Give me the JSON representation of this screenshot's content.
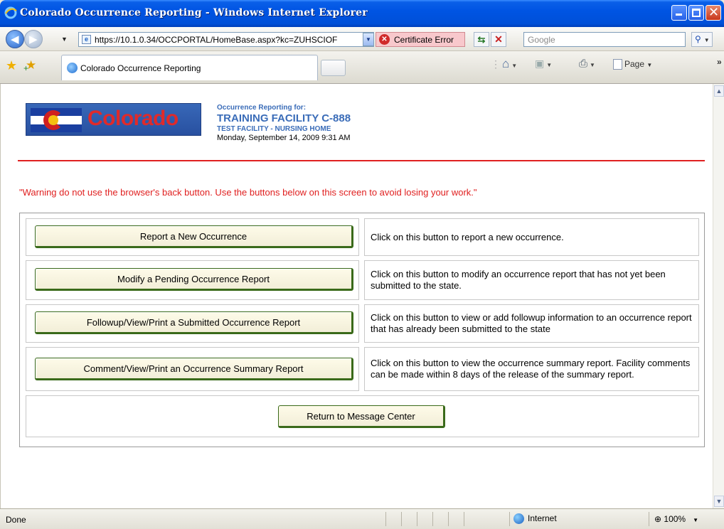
{
  "window": {
    "title": "Colorado Occurrence Reporting - Windows Internet Explorer"
  },
  "address_bar": {
    "url": "https://10.1.0.34/OCCPORTAL/HomeBase.aspx?kc=ZUHSCIOF",
    "cert_error": "Certificate Error",
    "search_placeholder": "Google"
  },
  "tabs": [
    {
      "label": "Colorado Occurrence Reporting"
    }
  ],
  "toolbar": {
    "page_label": "Page"
  },
  "header": {
    "logo_text": "Colorado",
    "reporting_for": "Occurrence Reporting for:",
    "facility_name": "TRAINING FACILITY C-888",
    "facility_type": "TEST FACILITY - NURSING HOME",
    "datetime": "Monday, September 14, 2009 9:31 AM"
  },
  "warning": "\"Warning do not use the browser's back button. Use the buttons below on this screen to avoid losing your work.\"",
  "actions": [
    {
      "button": "Report a New Occurrence",
      "description": "Click on this button to report a new occurrence."
    },
    {
      "button": "Modify a Pending Occurrence Report",
      "description": "Click on this button to modify an occurrence report that has not yet been submitted to the state."
    },
    {
      "button": "Followup/View/Print a Submitted Occurrence Report",
      "description": "Click on this button to view or add followup information to an occurrence report that has already been submitted to the state"
    },
    {
      "button": "Comment/View/Print an Occurrence Summary Report",
      "description": "Click on this button to view the occurrence summary report. Facility comments can be made within 8 days of the release of the summary report."
    }
  ],
  "return_button": "Return to Message Center",
  "status_bar": {
    "status": "Done",
    "zone": "Internet",
    "zoom": "100%"
  },
  "colors": {
    "title_blue": "#0054e3",
    "warning_red": "#e02020",
    "header_blue": "#3a6cb8",
    "button_border": "#3a6a1a"
  }
}
